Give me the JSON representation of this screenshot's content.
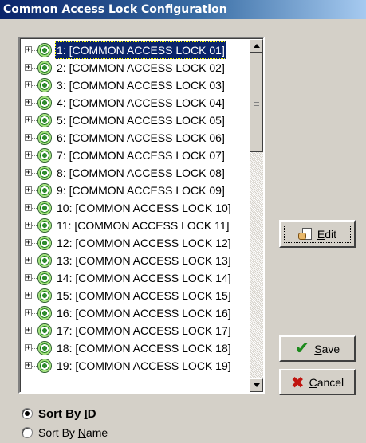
{
  "window": {
    "title": "Common Access Lock Configuration"
  },
  "tree": {
    "selected_index": 0,
    "items": [
      {
        "label": "1: [COMMON ACCESS LOCK 01]"
      },
      {
        "label": "2: [COMMON ACCESS LOCK 02]"
      },
      {
        "label": "3: [COMMON ACCESS LOCK 03]"
      },
      {
        "label": "4: [COMMON ACCESS LOCK 04]"
      },
      {
        "label": "5: [COMMON ACCESS LOCK 05]"
      },
      {
        "label": "6: [COMMON ACCESS LOCK 06]"
      },
      {
        "label": "7: [COMMON ACCESS LOCK 07]"
      },
      {
        "label": "8: [COMMON ACCESS LOCK 08]"
      },
      {
        "label": "9: [COMMON ACCESS LOCK 09]"
      },
      {
        "label": "10: [COMMON ACCESS LOCK 10]"
      },
      {
        "label": "11: [COMMON ACCESS LOCK 11]"
      },
      {
        "label": "12: [COMMON ACCESS LOCK 12]"
      },
      {
        "label": "13: [COMMON ACCESS LOCK 13]"
      },
      {
        "label": "14: [COMMON ACCESS LOCK 14]"
      },
      {
        "label": "15: [COMMON ACCESS LOCK 15]"
      },
      {
        "label": "16: [COMMON ACCESS LOCK 16]"
      },
      {
        "label": "17: [COMMON ACCESS LOCK 17]"
      },
      {
        "label": "18: [COMMON ACCESS LOCK 18]"
      },
      {
        "label": "19: [COMMON ACCESS LOCK 19]"
      }
    ],
    "expander_symbol": "+",
    "item_icon": "lock-target-icon"
  },
  "buttons": {
    "edit": {
      "prefix": "",
      "mnemonic": "E",
      "rest": "dit",
      "icon": "edit-hand-icon"
    },
    "save": {
      "mnemonic": "S",
      "rest": "ave",
      "icon": "check-icon",
      "icon_color": "#1c8a1c"
    },
    "cancel": {
      "mnemonic": "C",
      "rest": "ancel",
      "icon": "x-icon",
      "icon_color": "#c0140f"
    }
  },
  "sort": {
    "options": [
      {
        "prefix": "Sort By ",
        "mnemonic": "I",
        "rest": "D",
        "checked": true
      },
      {
        "prefix": "Sort By ",
        "mnemonic": "N",
        "rest": "ame",
        "checked": false
      }
    ]
  },
  "colors": {
    "title_bar": "#0a246a",
    "selection": "#0a246a",
    "face": "#d4d0c8"
  }
}
